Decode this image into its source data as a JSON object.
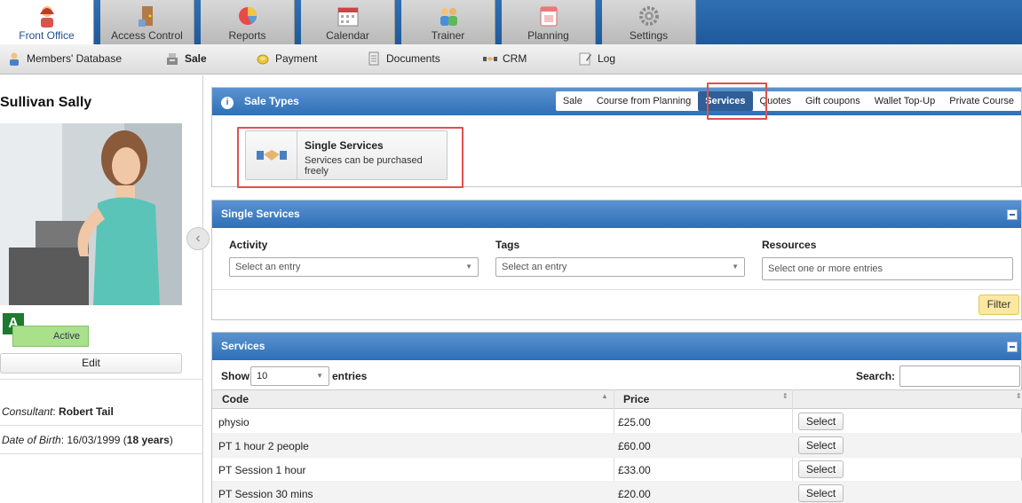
{
  "top_tabs": [
    {
      "label": "Front Office",
      "icon": "person-icon",
      "active": true
    },
    {
      "label": "Access Control",
      "icon": "door-icon"
    },
    {
      "label": "Reports",
      "icon": "pie-chart-icon"
    },
    {
      "label": "Calendar",
      "icon": "calendar-icon"
    },
    {
      "label": "Trainer",
      "icon": "trainer-icon"
    },
    {
      "label": "Planning",
      "icon": "planner-icon"
    },
    {
      "label": "Settings",
      "icon": "gear-icon"
    }
  ],
  "submenu": [
    {
      "label": "Members' Database",
      "icon": "members-icon"
    },
    {
      "label": "Sale",
      "icon": "cash-register-icon",
      "bold": true
    },
    {
      "label": "Payment",
      "icon": "coin-icon"
    },
    {
      "label": "Documents",
      "icon": "documents-icon"
    },
    {
      "label": "CRM",
      "icon": "handshake-icon"
    },
    {
      "label": "Log",
      "icon": "log-icon"
    }
  ],
  "member": {
    "name": "Sullivan Sally",
    "badge": "A",
    "status": "Active",
    "edit_label": "Edit",
    "consultant_label": "Consultant",
    "consultant": "Robert Tail",
    "dob_label": "Date of Birth",
    "dob": "16/03/1999",
    "age": "18 years"
  },
  "sale_types": {
    "title": "Sale Types",
    "tabs": [
      "Sale",
      "Course from Planning",
      "Services",
      "Quotes",
      "Gift coupons",
      "Wallet Top-Up",
      "Private Course"
    ],
    "active_tab": "Services",
    "card_title": "Single Services",
    "card_subtitle": "Services can be purchased freely"
  },
  "single_services": {
    "title": "Single Services",
    "activity_label": "Activity",
    "activity_placeholder": "Select an entry",
    "tags_label": "Tags",
    "tags_placeholder": "Select an entry",
    "resources_label": "Resources",
    "resources_placeholder": "Select one or more entries",
    "filter_label": "Filter"
  },
  "services_table": {
    "title": "Services",
    "show_label": "Show",
    "entries_value": "10",
    "entries_label": "entries",
    "search_label": "Search:",
    "columns": [
      "Code",
      "Price",
      ""
    ],
    "rows": [
      {
        "code": "physio",
        "price": "£25.00",
        "action": "Select"
      },
      {
        "code": "PT 1 hour 2 people",
        "price": "£60.00",
        "action": "Select"
      },
      {
        "code": "PT Session 1 hour",
        "price": "£33.00",
        "action": "Select"
      },
      {
        "code": "PT Session 30 mins",
        "price": "£20.00",
        "action": "Select"
      }
    ]
  },
  "colors": {
    "header_blue": "#2e6fb6",
    "highlight_red": "#e0504e",
    "active_green": "#1d7a2e"
  }
}
